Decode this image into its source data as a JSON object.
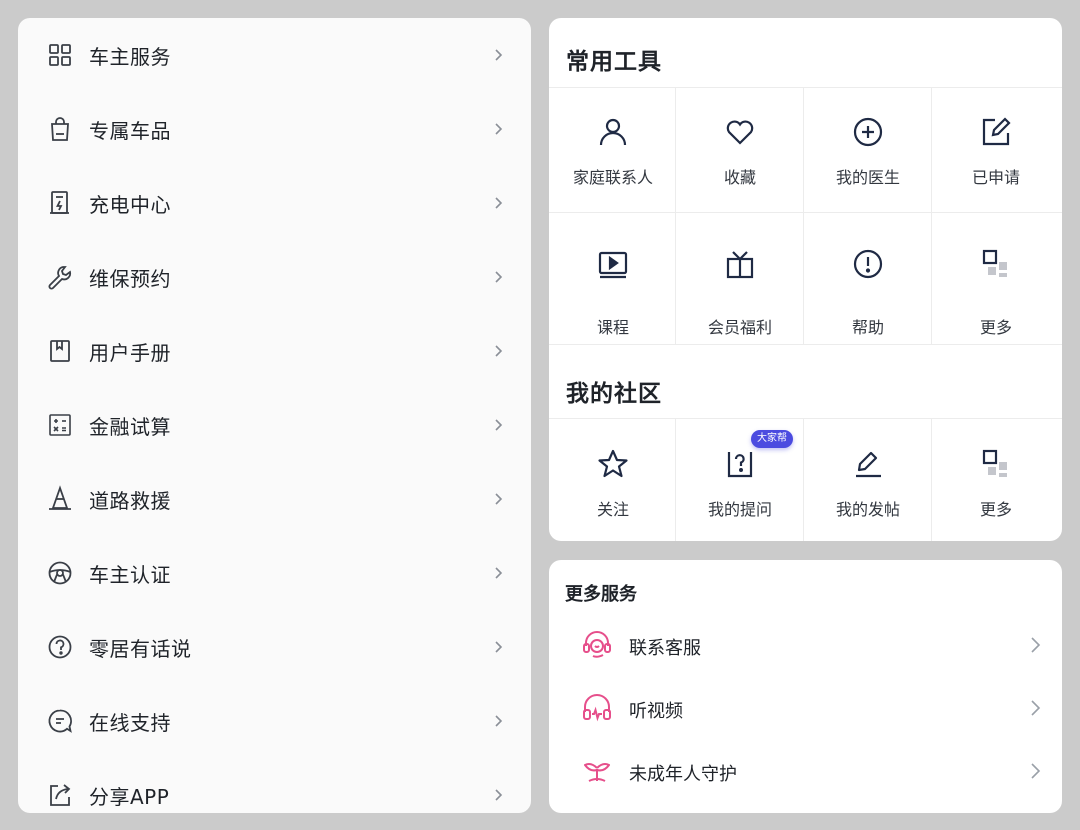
{
  "menu": {
    "items": [
      {
        "label": "车主服务",
        "icon": "grid-icon"
      },
      {
        "label": "专属车品",
        "icon": "shopping-bag-icon"
      },
      {
        "label": "充电中心",
        "icon": "charging-station-icon"
      },
      {
        "label": "维保预约",
        "icon": "wrench-icon"
      },
      {
        "label": "用户手册",
        "icon": "manual-book-icon"
      },
      {
        "label": "金融试算",
        "icon": "calculator-icon"
      },
      {
        "label": "道路救援",
        "icon": "traffic-cone-icon"
      },
      {
        "label": "车主认证",
        "icon": "steering-wheel-icon"
      },
      {
        "label": "零居有话说",
        "icon": "question-circle-icon"
      },
      {
        "label": "在线支持",
        "icon": "chat-bubble-icon"
      },
      {
        "label": "分享APP",
        "icon": "share-icon"
      }
    ]
  },
  "tools": {
    "title": "常用工具",
    "items": [
      {
        "label": "家庭联系人",
        "icon": "person-icon"
      },
      {
        "label": "收藏",
        "icon": "heart-icon"
      },
      {
        "label": "我的医生",
        "icon": "plus-circle-icon"
      },
      {
        "label": "已申请",
        "icon": "edit-square-icon"
      },
      {
        "label": "课程",
        "icon": "video-play-icon"
      },
      {
        "label": "会员福利",
        "icon": "gift-icon"
      },
      {
        "label": "帮助",
        "icon": "exclamation-circle-icon"
      },
      {
        "label": "更多",
        "icon": "more-grid-icon"
      }
    ]
  },
  "community": {
    "title": "我的社区",
    "badge": "大家帮",
    "items": [
      {
        "label": "关注",
        "icon": "star-icon"
      },
      {
        "label": "我的提问",
        "icon": "question-box-icon"
      },
      {
        "label": "我的发帖",
        "icon": "pencil-icon"
      },
      {
        "label": "更多",
        "icon": "more-grid-icon"
      }
    ]
  },
  "services": {
    "title": "更多服务",
    "accent": "#e64f8b",
    "items": [
      {
        "label": "联系客服",
        "icon": "headset-icon"
      },
      {
        "label": "听视频",
        "icon": "headphones-icon"
      },
      {
        "label": "未成年人守护",
        "icon": "sprout-icon"
      }
    ]
  }
}
